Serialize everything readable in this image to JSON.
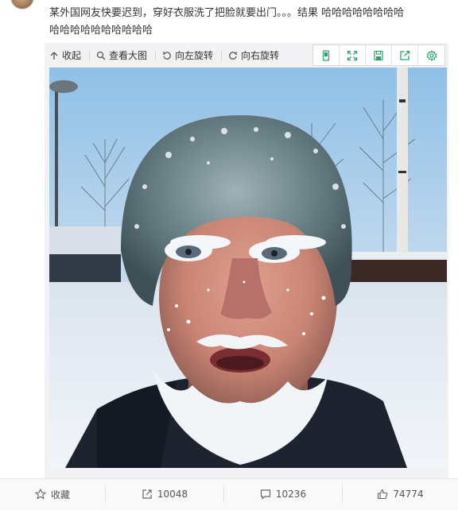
{
  "post": {
    "text": "某外国网友快要迟到，穿好衣服洗了把脸就要出门。。。结果 哈哈哈哈哈哈哈哈",
    "text_line2": "哈哈哈哈哈哈哈哈哈哈"
  },
  "toolbar": {
    "collapse_label": "收起",
    "view_large_label": "查看大图",
    "rotate_left_label": "向左旋转",
    "rotate_right_label": "向右旋转"
  },
  "icons": {
    "phone": "phone-icon",
    "expand": "expand-icon",
    "save": "save-icon",
    "share": "share-out-icon",
    "settings": "settings-icon",
    "accent": "#2fa36c"
  },
  "footer": {
    "favorite_label": "收藏",
    "repost_count": "10048",
    "comment_count": "10236",
    "like_count": "74774"
  }
}
